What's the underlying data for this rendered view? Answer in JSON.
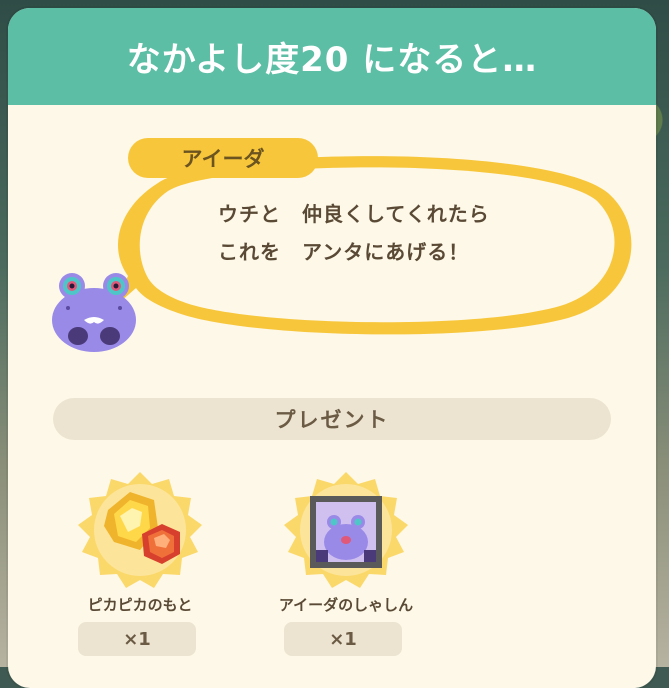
{
  "header": {
    "title": "なかよし度20 になると…"
  },
  "speaker": {
    "name": "アイーダ"
  },
  "dialog": {
    "line1": "ウチと　仲良くしてくれたら",
    "line2": "これを　アンタにあげる！"
  },
  "present": {
    "label": "プレゼント"
  },
  "items": [
    {
      "name": "ピカピカのもと",
      "count": "×1",
      "icon": "shiny-ore-icon"
    },
    {
      "name": "アイーダのしゃしん",
      "count": "×1",
      "icon": "framed-photo-icon"
    }
  ],
  "colors": {
    "header": "#5cbea5",
    "panel": "#fdf8e8",
    "bubble_border": "#f7c63a",
    "name_tag": "#f7c63a",
    "chip": "#ece4d0",
    "text": "#5a4a35"
  }
}
